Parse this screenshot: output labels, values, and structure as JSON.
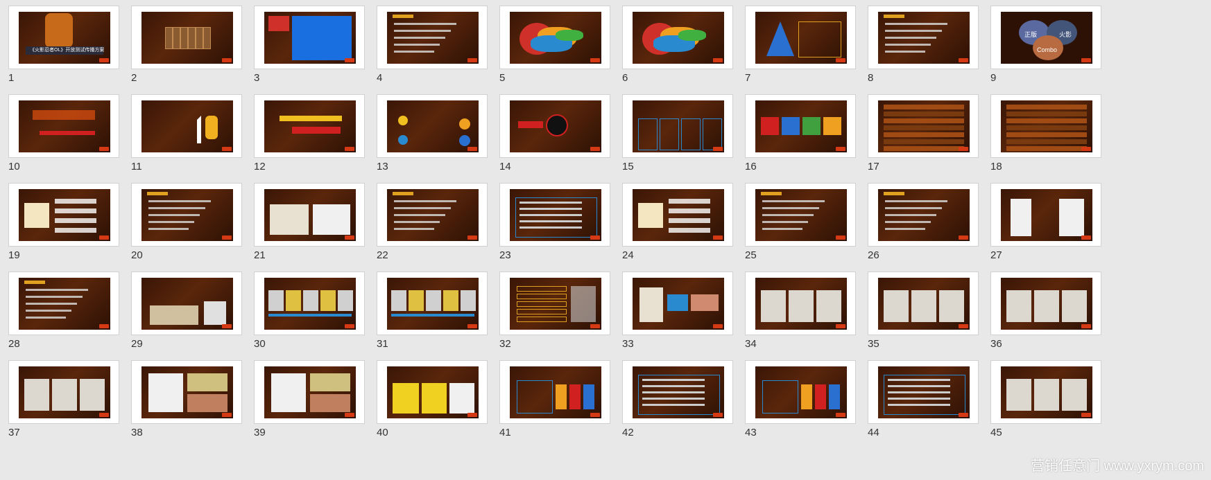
{
  "slides": [
    {
      "num": "1",
      "caption": "《火影忍者OL》开放测试传播方案"
    },
    {
      "num": "2"
    },
    {
      "num": "3"
    },
    {
      "num": "4"
    },
    {
      "num": "5"
    },
    {
      "num": "6"
    },
    {
      "num": "7"
    },
    {
      "num": "8"
    },
    {
      "num": "9",
      "words": [
        "正版",
        "火影",
        "Combo"
      ]
    },
    {
      "num": "10"
    },
    {
      "num": "11"
    },
    {
      "num": "12"
    },
    {
      "num": "13"
    },
    {
      "num": "14"
    },
    {
      "num": "15"
    },
    {
      "num": "16"
    },
    {
      "num": "17"
    },
    {
      "num": "18"
    },
    {
      "num": "19"
    },
    {
      "num": "20"
    },
    {
      "num": "21"
    },
    {
      "num": "22"
    },
    {
      "num": "23"
    },
    {
      "num": "24"
    },
    {
      "num": "25"
    },
    {
      "num": "26"
    },
    {
      "num": "27"
    },
    {
      "num": "28"
    },
    {
      "num": "29"
    },
    {
      "num": "30"
    },
    {
      "num": "31"
    },
    {
      "num": "32"
    },
    {
      "num": "33"
    },
    {
      "num": "34"
    },
    {
      "num": "35"
    },
    {
      "num": "36"
    },
    {
      "num": "37"
    },
    {
      "num": "38"
    },
    {
      "num": "39"
    },
    {
      "num": "40"
    },
    {
      "num": "41"
    },
    {
      "num": "42"
    },
    {
      "num": "43"
    },
    {
      "num": "44"
    },
    {
      "num": "45"
    }
  ],
  "watermark": "营销任意门 www.yxrym.com",
  "colors": {
    "background": "#e8e8e8",
    "slide_bg": "#4a1e08",
    "accent": "#e0a020",
    "logo": "#d63a14"
  }
}
